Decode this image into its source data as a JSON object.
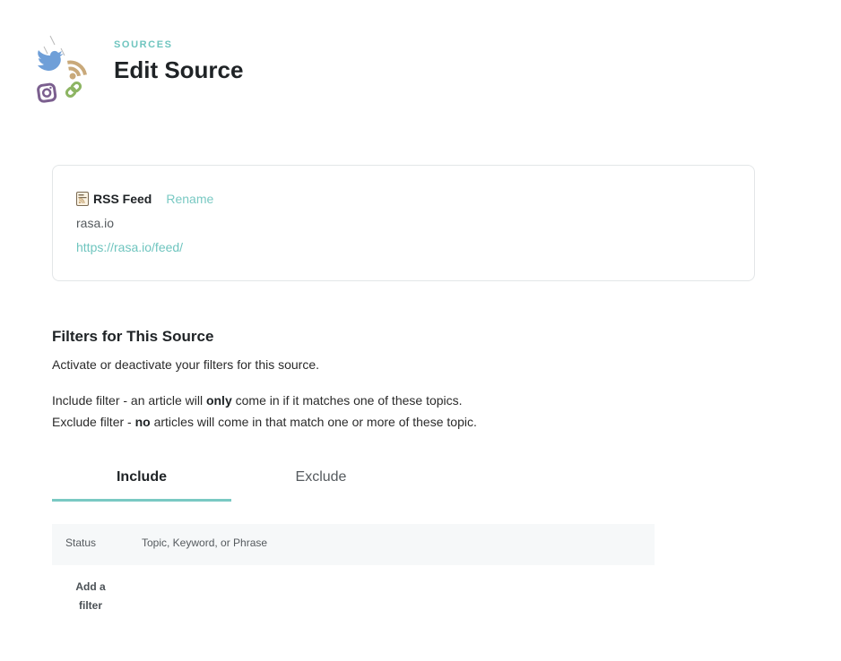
{
  "header": {
    "breadcrumb": "SOURCES",
    "title": "Edit Source"
  },
  "source_card": {
    "type_label": "RSS Feed",
    "rename_label": "Rename",
    "domain": "rasa.io",
    "url": "https://rasa.io/feed/"
  },
  "filters": {
    "title": "Filters for This Source",
    "description": "Activate or deactivate your filters for this source.",
    "include_desc": {
      "prefix": "Include filter - an article will ",
      "emphasis": "only",
      "suffix": " come in if it matches one of these topics."
    },
    "exclude_desc": {
      "prefix": "Exclude filter - ",
      "emphasis": "no",
      "suffix": " articles will come in that match one or more of these topic."
    },
    "tabs": [
      {
        "label": "Include",
        "active": true
      },
      {
        "label": "Exclude",
        "active": false
      }
    ],
    "table": {
      "columns": [
        "Status",
        "Topic, Keyword, or Phrase"
      ],
      "add_filter_label": "Add a filter"
    }
  },
  "colors": {
    "accent": "#79c9c3",
    "twitter": "#6f9fd8",
    "rss": "#c9a97a",
    "instagram": "#7b5f8f",
    "link": "#8db563"
  },
  "icons": [
    "twitter-icon",
    "rss-icon",
    "instagram-icon",
    "link-icon",
    "rss-document-icon"
  ]
}
